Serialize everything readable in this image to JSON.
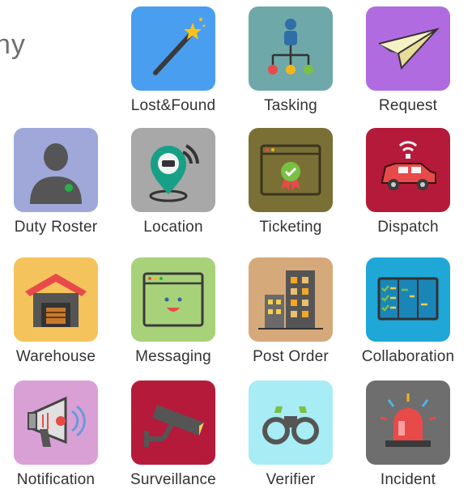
{
  "header": {
    "partial_title": "ny"
  },
  "tiles": [
    {
      "label": "Lost&Found",
      "icon": "magic-wand-icon",
      "color": "#4a9ef0"
    },
    {
      "label": "Tasking",
      "icon": "org-chart-icon",
      "color": "#6fa8a8"
    },
    {
      "label": "Request",
      "icon": "paper-plane-icon",
      "color": "#b06be0"
    },
    {
      "label": "Duty Roster",
      "icon": "user-icon",
      "color": "#9fa8d9"
    },
    {
      "label": "Location",
      "icon": "location-pin-icon",
      "color": "#a8a8a8"
    },
    {
      "label": "Ticketing",
      "icon": "certificate-icon",
      "color": "#7a7035"
    },
    {
      "label": "Dispatch",
      "icon": "vehicle-icon",
      "color": "#b51a3a"
    },
    {
      "label": "Warehouse",
      "icon": "warehouse-icon",
      "color": "#f5c35c"
    },
    {
      "label": "Messaging",
      "icon": "chat-window-icon",
      "color": "#a8d27a"
    },
    {
      "label": "Post Order",
      "icon": "building-icon",
      "color": "#d6a97a"
    },
    {
      "label": "Collaboration",
      "icon": "board-icon",
      "color": "#1fa7d8"
    },
    {
      "label": "Notification",
      "icon": "megaphone-icon",
      "color": "#d9a0d6"
    },
    {
      "label": "Surveillance",
      "icon": "cctv-camera-icon",
      "color": "#b51a3a"
    },
    {
      "label": "Verifier",
      "icon": "binoculars-icon",
      "color": "#a8ecf5"
    },
    {
      "label": "Incident",
      "icon": "alarm-light-icon",
      "color": "#6e6e6e"
    }
  ]
}
